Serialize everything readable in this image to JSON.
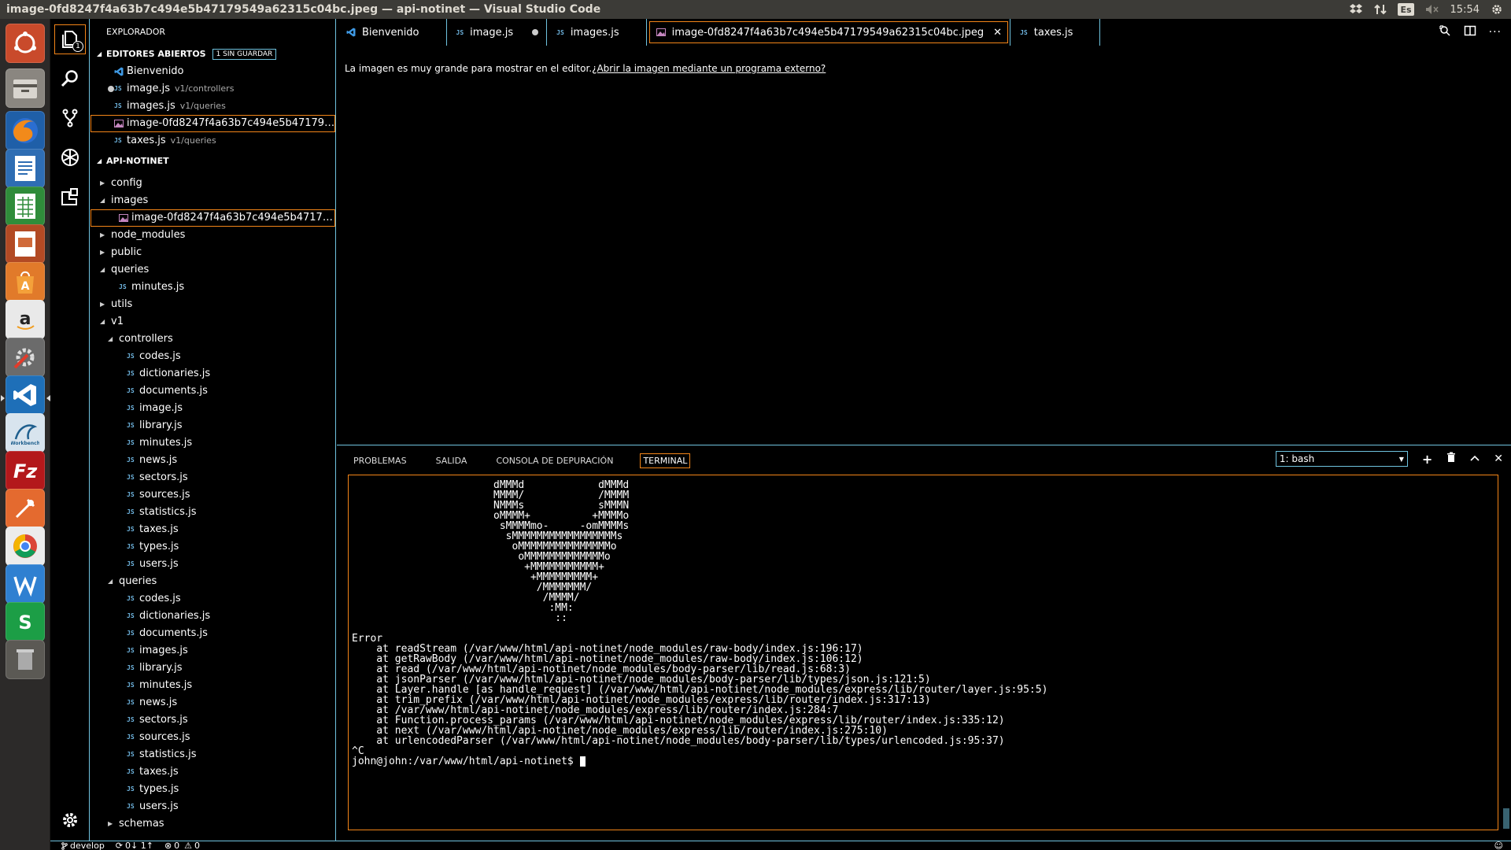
{
  "window": {
    "title": "image-0fd8247f4a63b7c494e5b47179549a62315c04bc.jpeg — api-notinet — Visual Studio Code"
  },
  "tray": {
    "keyboard": "Es",
    "clock": "15:54"
  },
  "launcher": {
    "items": [
      "dash",
      "files",
      "firefox",
      "writer",
      "calc",
      "impress",
      "software-center",
      "amazon",
      "system-settings",
      "vscode",
      "mysql-workbench",
      "filezilla",
      "postman",
      "chrome",
      "wps-writer",
      "wps-spreadsheets",
      "trash"
    ]
  },
  "activity": {
    "explorer_badge": "1"
  },
  "sidebar": {
    "title": "EXPLORADOR",
    "open_editors": {
      "header": "EDITORES ABIERTOS",
      "badge": "1 SIN GUARDAR",
      "items": [
        {
          "label": "Bienvenido",
          "desc": "",
          "kind": "vscode"
        },
        {
          "label": "image.js",
          "desc": "v1/controllers",
          "kind": "js",
          "dirty": true
        },
        {
          "label": "images.js",
          "desc": "v1/queries",
          "kind": "js"
        },
        {
          "label": "image-0fd8247f4a63b7c494e5b4717954...",
          "desc": "",
          "kind": "img",
          "selected": true
        },
        {
          "label": "taxes.js",
          "desc": "v1/queries",
          "kind": "js"
        }
      ]
    },
    "project": {
      "header": "API-NOTINET",
      "tree": [
        {
          "label": "config",
          "kind": "folder",
          "depth": 0,
          "open": false
        },
        {
          "label": "images",
          "kind": "folder",
          "depth": 0,
          "open": true
        },
        {
          "label": "image-0fd8247f4a63b7c494e5b47179549a...",
          "kind": "img",
          "depth": 1,
          "selected": true
        },
        {
          "label": "node_modules",
          "kind": "folder",
          "depth": 0,
          "open": false
        },
        {
          "label": "public",
          "kind": "folder",
          "depth": 0,
          "open": false
        },
        {
          "label": "queries",
          "kind": "folder",
          "depth": 0,
          "open": true
        },
        {
          "label": "minutes.js",
          "kind": "js",
          "depth": 1
        },
        {
          "label": "utils",
          "kind": "folder",
          "depth": 0,
          "open": false
        },
        {
          "label": "v1",
          "kind": "folder",
          "depth": 0,
          "open": true
        },
        {
          "label": "controllers",
          "kind": "folder",
          "depth": 1,
          "open": true
        },
        {
          "label": "codes.js",
          "kind": "js",
          "depth": 2
        },
        {
          "label": "dictionaries.js",
          "kind": "js",
          "depth": 2
        },
        {
          "label": "documents.js",
          "kind": "js",
          "depth": 2
        },
        {
          "label": "image.js",
          "kind": "js",
          "depth": 2
        },
        {
          "label": "library.js",
          "kind": "js",
          "depth": 2
        },
        {
          "label": "minutes.js",
          "kind": "js",
          "depth": 2
        },
        {
          "label": "news.js",
          "kind": "js",
          "depth": 2
        },
        {
          "label": "sectors.js",
          "kind": "js",
          "depth": 2
        },
        {
          "label": "sources.js",
          "kind": "js",
          "depth": 2
        },
        {
          "label": "statistics.js",
          "kind": "js",
          "depth": 2
        },
        {
          "label": "taxes.js",
          "kind": "js",
          "depth": 2
        },
        {
          "label": "types.js",
          "kind": "js",
          "depth": 2
        },
        {
          "label": "users.js",
          "kind": "js",
          "depth": 2
        },
        {
          "label": "queries",
          "kind": "folder",
          "depth": 1,
          "open": true
        },
        {
          "label": "codes.js",
          "kind": "js",
          "depth": 2
        },
        {
          "label": "dictionaries.js",
          "kind": "js",
          "depth": 2
        },
        {
          "label": "documents.js",
          "kind": "js",
          "depth": 2
        },
        {
          "label": "images.js",
          "kind": "js",
          "depth": 2
        },
        {
          "label": "library.js",
          "kind": "js",
          "depth": 2
        },
        {
          "label": "minutes.js",
          "kind": "js",
          "depth": 2
        },
        {
          "label": "news.js",
          "kind": "js",
          "depth": 2
        },
        {
          "label": "sectors.js",
          "kind": "js",
          "depth": 2
        },
        {
          "label": "sources.js",
          "kind": "js",
          "depth": 2
        },
        {
          "label": "statistics.js",
          "kind": "js",
          "depth": 2
        },
        {
          "label": "taxes.js",
          "kind": "js",
          "depth": 2
        },
        {
          "label": "types.js",
          "kind": "js",
          "depth": 2
        },
        {
          "label": "users.js",
          "kind": "js",
          "depth": 2
        },
        {
          "label": "schemas",
          "kind": "folder",
          "depth": 1,
          "open": false
        }
      ]
    }
  },
  "tabs": [
    {
      "label": "Bienvenido",
      "kind": "vscode"
    },
    {
      "label": "image.js",
      "kind": "js",
      "dirty": true
    },
    {
      "label": "images.js",
      "kind": "js"
    },
    {
      "label": "image-0fd8247f4a63b7c494e5b47179549a62315c04bc.jpeg",
      "kind": "img",
      "active": true
    },
    {
      "label": "taxes.js",
      "kind": "js"
    }
  ],
  "editor": {
    "message": "La imagen es muy grande para mostrar en el editor.",
    "link": "¿Abrir la imagen mediante un programa externo?"
  },
  "panel": {
    "tabs": [
      "PROBLEMAS",
      "SALIDA",
      "CONSOLA DE DEPURACIÓN",
      "TERMINAL"
    ],
    "active_tab": "TERMINAL",
    "terminal_select": "1: bash",
    "terminal_lines": [
      "                       dMMMd            dMMMd",
      "                       MMMM/            /MMMM",
      "                       NMMMs            sMMMN",
      "                       oMMMM+          +MMMMo",
      "                        sMMMMmo-     -omMMMMs",
      "                         sMMMMMMMMMMMMMMMMMs",
      "                          oMMMMMMMMMMMMMMMo",
      "                           oMMMMMMMMMMMMMo",
      "                            +MMMMMMMMMMM+",
      "                             +MMMMMMMMM+",
      "                              /MMMMMMM/",
      "                               /MMMM/",
      "                                :MM:",
      "                                 ::",
      "",
      "Error",
      "    at readStream (/var/www/html/api-notinet/node_modules/raw-body/index.js:196:17)",
      "    at getRawBody (/var/www/html/api-notinet/node_modules/raw-body/index.js:106:12)",
      "    at read (/var/www/html/api-notinet/node_modules/body-parser/lib/read.js:68:3)",
      "    at jsonParser (/var/www/html/api-notinet/node_modules/body-parser/lib/types/json.js:121:5)",
      "    at Layer.handle [as handle_request] (/var/www/html/api-notinet/node_modules/express/lib/router/layer.js:95:5)",
      "    at trim_prefix (/var/www/html/api-notinet/node_modules/express/lib/router/index.js:317:13)",
      "    at /var/www/html/api-notinet/node_modules/express/lib/router/index.js:284:7",
      "    at Function.process_params (/var/www/html/api-notinet/node_modules/express/lib/router/index.js:335:12)",
      "    at next (/var/www/html/api-notinet/node_modules/express/lib/router/index.js:275:10)",
      "    at urlencodedParser (/var/www/html/api-notinet/node_modules/body-parser/lib/types/urlencoded.js:95:37)",
      "^C"
    ],
    "prompt": "john@john:/var/www/html/api-notinet$ "
  },
  "status": {
    "branch": "develop",
    "sync": "0↓ 1↑",
    "errors": "0",
    "warnings": "0"
  },
  "colors": {
    "contrast_border": "#6fc3df",
    "focus_border": "#f38518",
    "js_icon": "#6fb5e0"
  }
}
